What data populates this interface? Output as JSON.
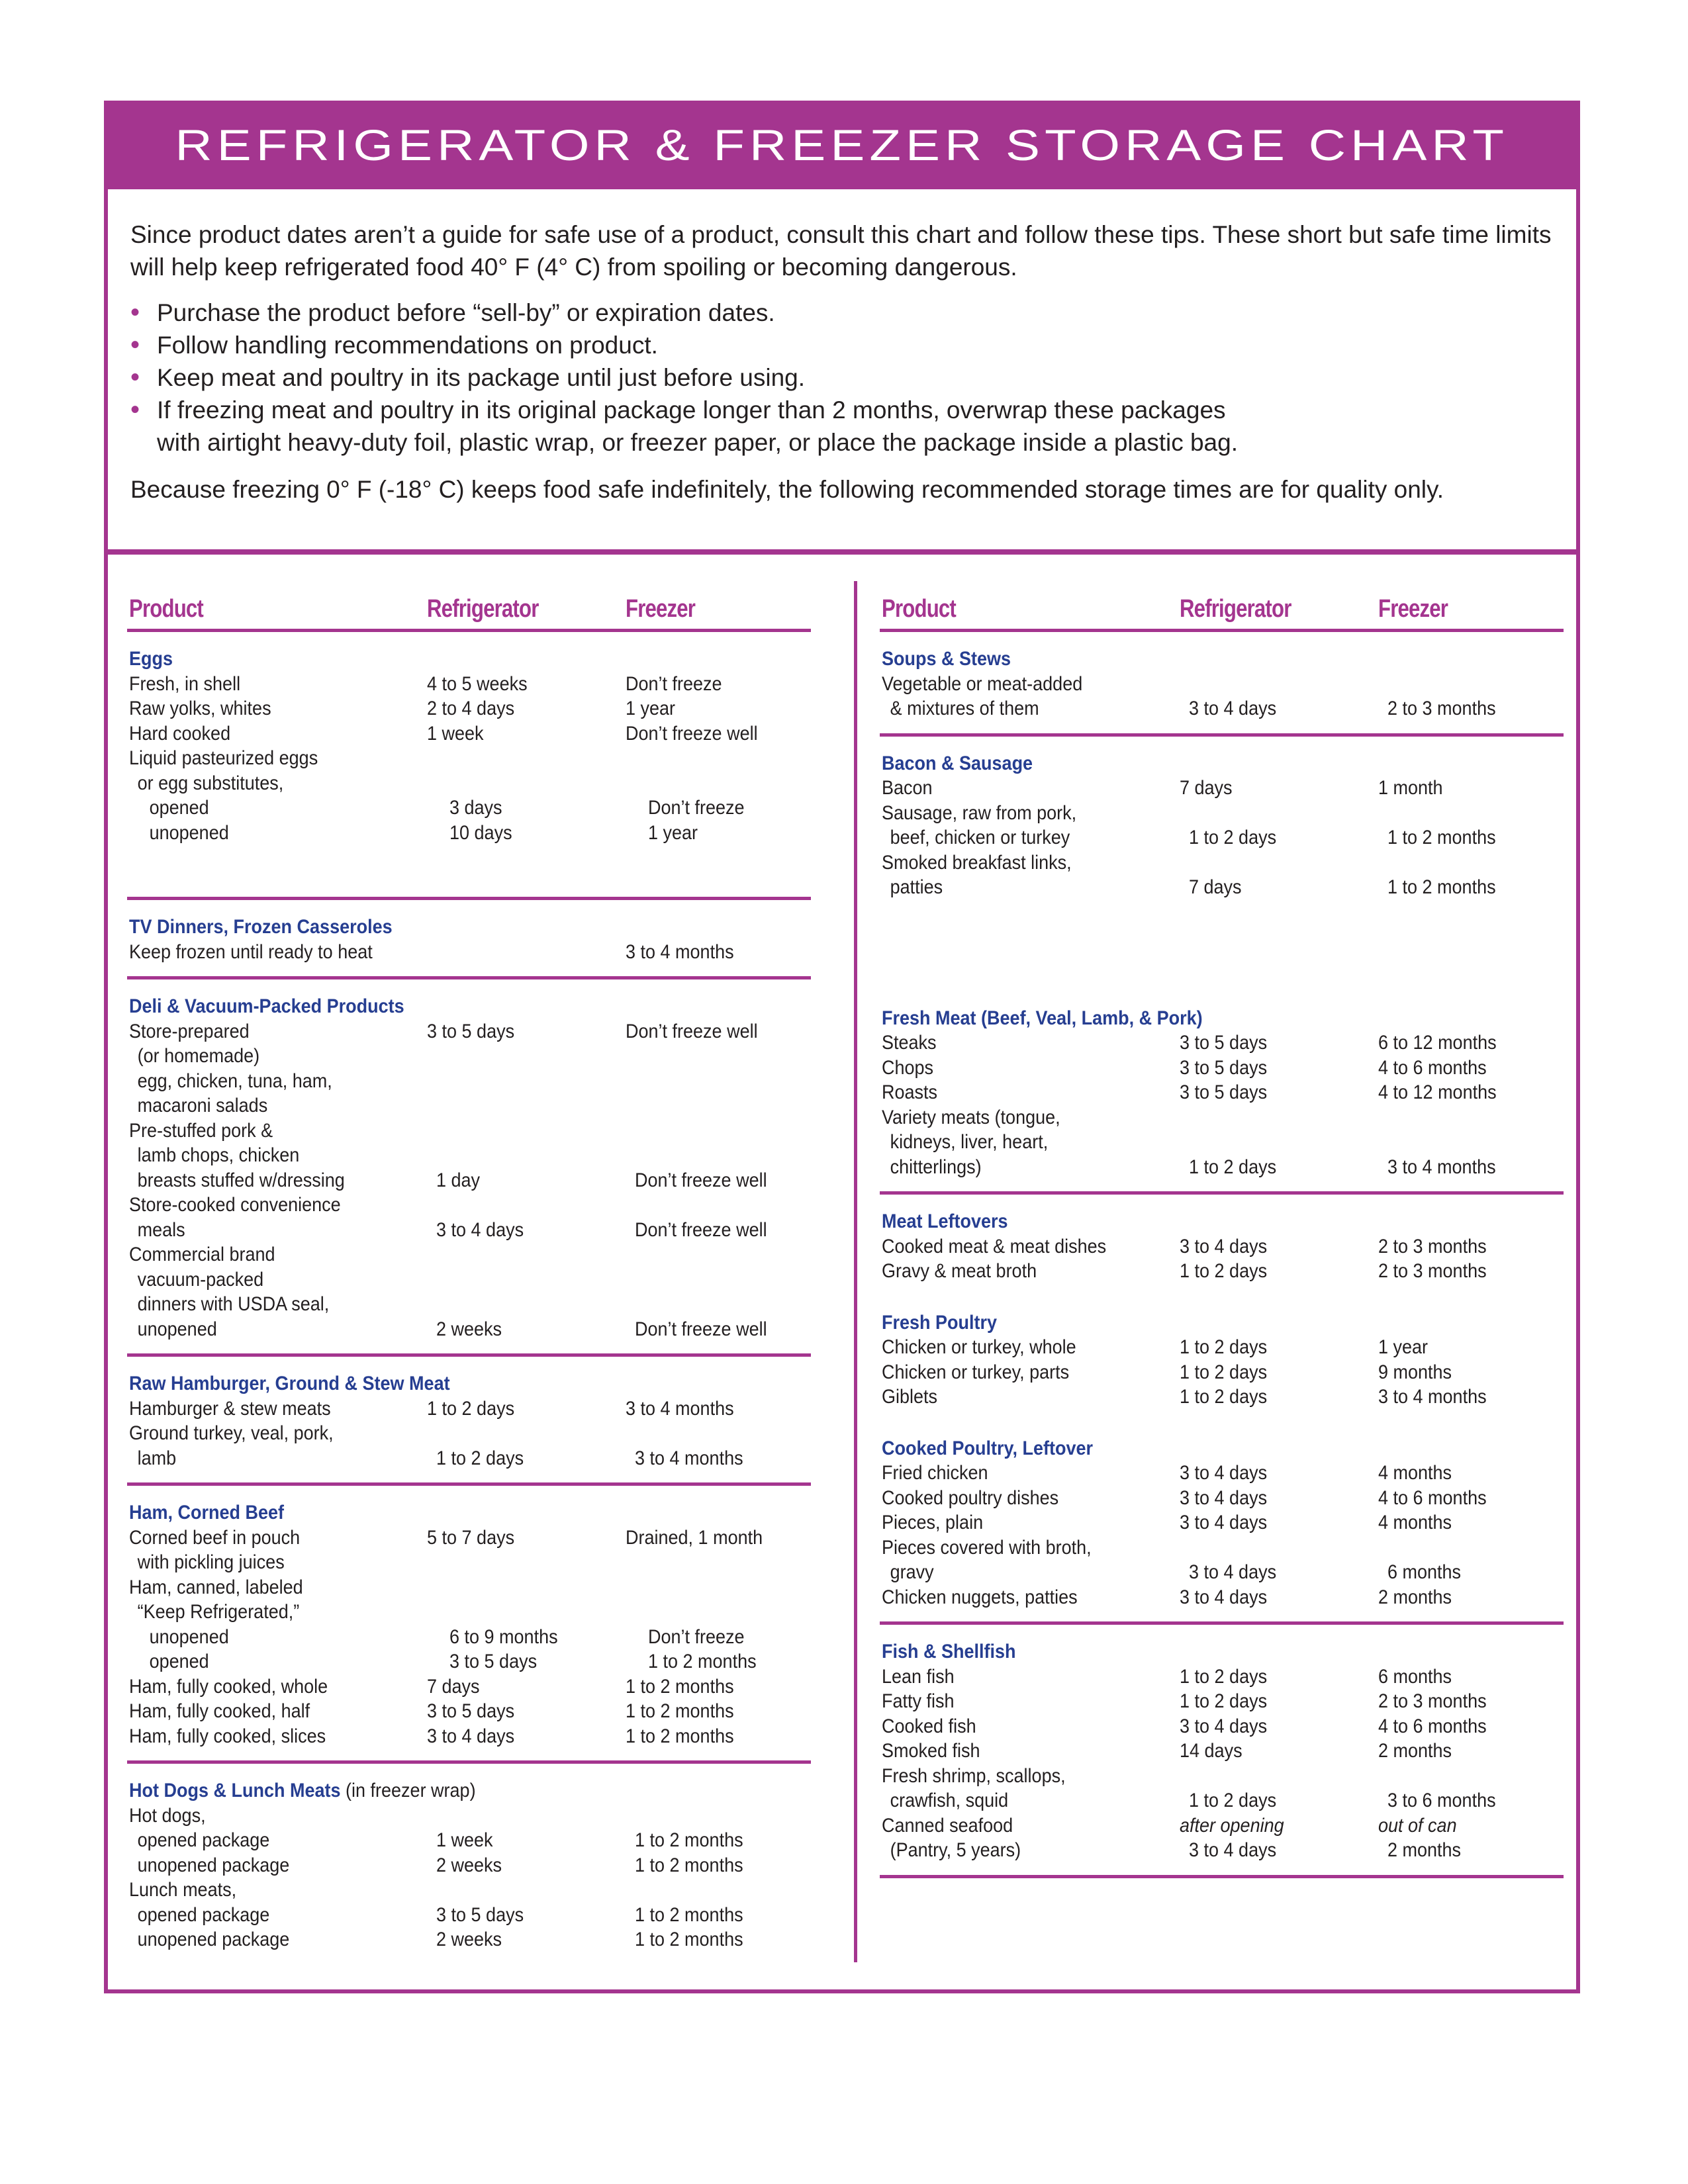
{
  "header": {
    "title": "REFRIGERATOR & FREEZER STORAGE CHART"
  },
  "colors": {
    "accent": "#a4358f",
    "section_title": "#263e91",
    "text": "#231f20"
  },
  "intro": {
    "lead": "Since product dates aren’t a guide for safe use of a product, consult this chart and follow these tips. These short but safe time limits will help keep refrigerated food 40° F (4° C) from spoiling or becoming dangerous.",
    "tips": [
      "Purchase the product before “sell-by” or expiration dates.",
      "Follow handling recommendations on product.",
      "Keep meat and poultry in its package until just before using.",
      "If freezing meat and poultry in its original package longer than 2 months, overwrap these packages",
      "with airtight heavy-duty foil, plastic wrap, or freezer paper, or place the package inside a plastic bag."
    ],
    "closing": "Because freezing 0° F (-18° C) keeps food safe indefinitely, the following recommended storage times are for quality only."
  },
  "columns_header": {
    "product": "Product",
    "refrigerator": "Refrigerator",
    "freezer": "Freezer"
  },
  "left": [
    {
      "title": "Eggs",
      "rows": [
        [
          "Fresh, in shell",
          "4 to 5 weeks",
          "Don’t freeze",
          0
        ],
        [
          "Raw yolks, whites",
          "2 to 4 days",
          "1 year",
          0
        ],
        [
          "Hard cooked",
          "1 week",
          "Don’t freeze well",
          0
        ],
        [
          "Liquid pasteurized eggs",
          "",
          "",
          0
        ],
        [
          "or egg substitutes,",
          "",
          "",
          1
        ],
        [
          "opened",
          "3 days",
          "Don’t freeze",
          2
        ],
        [
          "unopened",
          "10 days",
          "1 year",
          2
        ]
      ]
    },
    {
      "title": "TV Dinners, Frozen Casseroles",
      "rows": [
        [
          "Keep frozen until ready to heat",
          "",
          "3 to 4 months",
          0
        ]
      ]
    },
    {
      "title": "Deli & Vacuum-Packed Products",
      "rows": [
        [
          "Store-prepared",
          "3 to 5 days",
          "Don’t freeze well",
          0
        ],
        [
          "(or homemade)",
          "",
          "",
          1
        ],
        [
          "egg, chicken, tuna, ham,",
          "",
          "",
          1
        ],
        [
          "macaroni salads",
          "",
          "",
          1
        ],
        [
          "Pre-stuffed pork &",
          "",
          "",
          0
        ],
        [
          "lamb chops, chicken",
          "",
          "",
          1
        ],
        [
          "breasts stuffed w/dressing",
          "1 day",
          "Don’t freeze well",
          1
        ],
        [
          "Store-cooked convenience",
          "",
          "",
          0
        ],
        [
          "meals",
          "3 to 4 days",
          "Don’t freeze well",
          1
        ],
        [
          "Commercial brand",
          "",
          "",
          0
        ],
        [
          "vacuum-packed",
          "",
          "",
          1
        ],
        [
          "dinners with USDA seal,",
          "",
          "",
          1
        ],
        [
          "unopened",
          "2 weeks",
          "Don’t freeze well",
          1
        ]
      ]
    },
    {
      "title": "Raw Hamburger, Ground & Stew Meat",
      "rows": [
        [
          "Hamburger & stew meats",
          "1 to 2 days",
          "3 to 4 months",
          0
        ],
        [
          "Ground turkey, veal, pork,",
          "",
          "",
          0
        ],
        [
          "lamb",
          "1 to 2 days",
          "3 to 4 months",
          1
        ]
      ]
    },
    {
      "title": "Ham, Corned Beef",
      "rows": [
        [
          "Corned beef in pouch",
          "5 to 7 days",
          "Drained, 1 month",
          0
        ],
        [
          "with pickling juices",
          "",
          "",
          1
        ],
        [
          "Ham, canned, labeled",
          "",
          "",
          0
        ],
        [
          "“Keep Refrigerated,”",
          "",
          "",
          1
        ],
        [
          "unopened",
          "6 to 9 months",
          "Don’t freeze",
          2
        ],
        [
          "opened",
          "3 to 5 days",
          "1 to 2 months",
          2
        ],
        [
          "Ham, fully cooked, whole",
          "7 days",
          "1 to 2 months",
          0
        ],
        [
          "Ham, fully cooked, half",
          "3 to 5 days",
          "1 to 2 months",
          0
        ],
        [
          "Ham, fully cooked, slices",
          "3 to 4 days",
          "1 to 2 months",
          0
        ]
      ]
    },
    {
      "title": "Hot Dogs & Lunch Meats",
      "note": " (in freezer wrap)",
      "rows": [
        [
          "Hot dogs,",
          "",
          "",
          0
        ],
        [
          "opened package",
          "1 week",
          "1 to 2 months",
          1
        ],
        [
          "unopened package",
          "2 weeks",
          "1 to 2 months",
          1
        ],
        [
          "Lunch meats,",
          "",
          "",
          0
        ],
        [
          "opened package",
          "3 to 5 days",
          "1 to 2 months",
          1
        ],
        [
          "unopened package",
          "2 weeks",
          "1 to 2 months",
          1
        ]
      ]
    }
  ],
  "right": [
    {
      "title": "Soups & Stews",
      "rows": [
        [
          "Vegetable or meat-added",
          "",
          "",
          0
        ],
        [
          "& mixtures of them",
          "3 to 4 days",
          "2 to 3 months",
          1
        ]
      ]
    },
    {
      "title": "Bacon & Sausage",
      "rows": [
        [
          "Bacon",
          "7 days",
          "1 month",
          0
        ],
        [
          "Sausage, raw from pork,",
          "",
          "",
          0
        ],
        [
          "beef, chicken or turkey",
          "1 to 2 days",
          "1 to 2 months",
          1
        ],
        [
          "Smoked breakfast links,",
          "",
          "",
          0
        ],
        [
          "patties",
          "7 days",
          "1 to 2 months",
          1
        ]
      ]
    },
    {
      "title": "Fresh Meat (Beef, Veal, Lamb, & Pork)",
      "rows": [
        [
          "Steaks",
          "3 to 5 days",
          "6 to 12 months",
          0
        ],
        [
          "Chops",
          "3 to 5 days",
          "4 to 6 months",
          0
        ],
        [
          "Roasts",
          "3 to 5 days",
          "4 to 12 months",
          0
        ],
        [
          "Variety meats (tongue,",
          "",
          "",
          0
        ],
        [
          "kidneys, liver, heart,",
          "",
          "",
          1
        ],
        [
          "chitterlings)",
          "1 to 2 days",
          "3 to 4 months",
          1
        ]
      ]
    },
    {
      "title": "Meat Leftovers",
      "rows": [
        [
          "Cooked meat & meat dishes",
          "3 to 4 days",
          "2 to 3 months",
          0
        ],
        [
          "Gravy & meat broth",
          "1 to 2 days",
          "2 to 3 months",
          0
        ]
      ]
    },
    {
      "title": "Fresh Poultry",
      "rows": [
        [
          "Chicken or turkey, whole",
          "1 to 2 days",
          "1 year",
          0
        ],
        [
          "Chicken or turkey, parts",
          "1 to 2 days",
          "9 months",
          0
        ],
        [
          "Giblets",
          "1 to 2 days",
          "3 to 4 months",
          0
        ]
      ]
    },
    {
      "title": "Cooked Poultry, Leftover",
      "rows": [
        [
          "Fried chicken",
          "3 to 4 days",
          "4 months",
          0
        ],
        [
          "Cooked poultry dishes",
          "3 to 4 days",
          "4 to 6 months",
          0
        ],
        [
          "Pieces, plain",
          "3 to 4 days",
          "4 months",
          0
        ],
        [
          "Pieces covered with broth,",
          "",
          "",
          0
        ],
        [
          "gravy",
          "3 to 4 days",
          "6 months",
          1
        ],
        [
          "Chicken nuggets, patties",
          "3 to 4 days",
          "2 months",
          0
        ]
      ]
    },
    {
      "title": "Fish & Shellfish",
      "rows": [
        [
          "Lean fish",
          "1 to 2 days",
          "6 months",
          0
        ],
        [
          "Fatty fish",
          "1 to 2 days",
          "2 to 3 months",
          0
        ],
        [
          "Cooked fish",
          "3 to 4 days",
          "4 to 6 months",
          0
        ],
        [
          "Smoked fish",
          "14 days",
          "2 months",
          0
        ],
        [
          "Fresh shrimp, scallops,",
          "",
          "",
          0
        ],
        [
          "crawfish, squid",
          "1 to 2 days",
          "3 to 6 months",
          1
        ],
        [
          "Canned seafood",
          "after opening",
          "out of can",
          0,
          "italic"
        ],
        [
          "(Pantry, 5 years)",
          "3 to 4 days",
          "2 months",
          1
        ]
      ]
    }
  ],
  "layout_rules": {
    "left_rule_after": [
      true,
      true,
      true,
      true,
      true,
      false
    ],
    "right_rule_after": [
      true,
      false,
      true,
      false,
      false,
      true,
      true,
      false
    ]
  }
}
